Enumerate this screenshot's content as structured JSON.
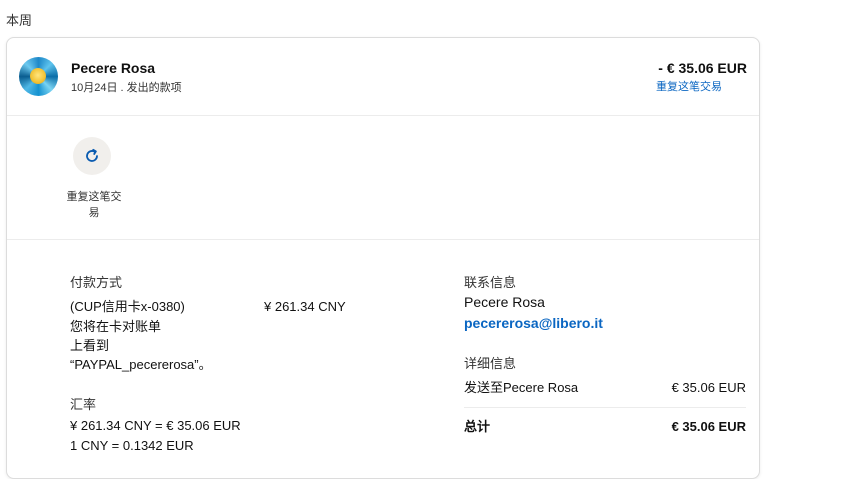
{
  "section_label": "本周",
  "transaction": {
    "merchant": "Pecere Rosa",
    "date_line": "10月24日 . 发出的款项",
    "amount": "- € 35.06 EUR",
    "repeat_link": "重复这笔交易"
  },
  "actions": {
    "repeat_label": "重复这笔交易",
    "icon": "refresh-icon"
  },
  "payment": {
    "title": "付款方式",
    "method_lines": [
      "(CUP信用卡x-0380)",
      "您将在卡对账单",
      "上看到",
      "“PAYPAL_pecererosa”。"
    ],
    "amount": "¥ 261.34 CNY"
  },
  "exchange": {
    "title": "汇率",
    "line1": "¥ 261.34 CNY = € 35.06 EUR",
    "line2": "1 CNY = 0.1342 EUR"
  },
  "contact": {
    "title": "联系信息",
    "name": "Pecere Rosa",
    "email": "pecererosa@libero.it"
  },
  "details": {
    "title": "详细信息",
    "sent_to_label": "发送至Pecere Rosa",
    "sent_to_amount": "€ 35.06 EUR",
    "total_label": "总计",
    "total_amount": "€ 35.06 EUR"
  },
  "colors": {
    "link": "#0a66c2",
    "button_bg": "#f1efec"
  }
}
